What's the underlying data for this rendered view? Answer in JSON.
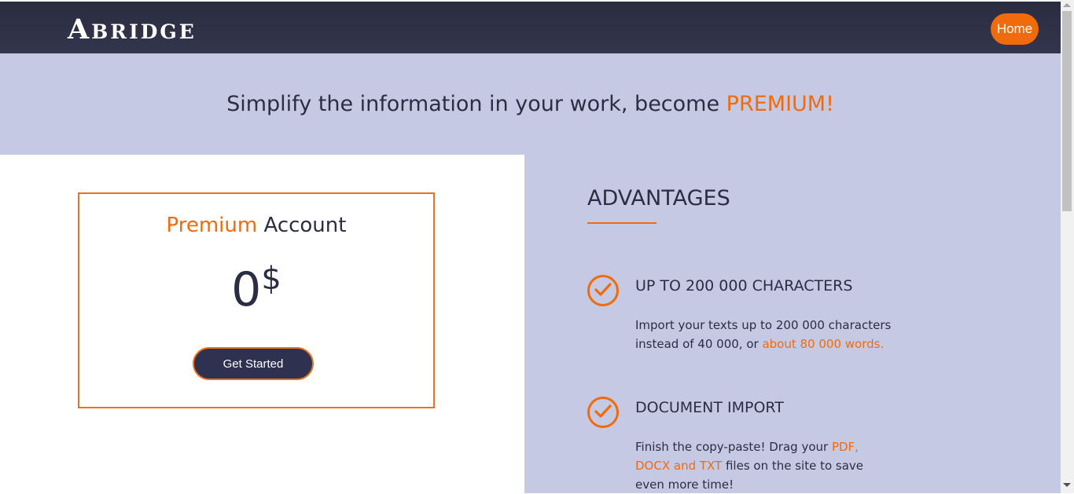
{
  "header": {
    "logo": "Abridge",
    "home_label": "Home"
  },
  "hero": {
    "title_prefix": "Simplify the information in your work, become ",
    "title_highlight": "PREMIUM!"
  },
  "pricing": {
    "title_highlight": "Premium",
    "title_rest": " Account",
    "price": "0",
    "currency": "$",
    "cta_label": "Get Started"
  },
  "advantages": {
    "title": "ADVANTAGES",
    "items": [
      {
        "icon": "check-circle-icon",
        "heading": "UP TO 200 000 CHARACTERS",
        "text_parts": [
          "Import your texts up to 200 000 characters instead of 40 000, or ",
          "about 80 000 words.",
          ""
        ]
      },
      {
        "icon": "check-circle-icon",
        "heading": "DOCUMENT IMPORT",
        "text_parts": [
          "Finish the copy-paste! Drag your ",
          "PDF, DOCX and TXT",
          " files on the site to save even more time!"
        ]
      }
    ]
  },
  "colors": {
    "accent": "#f06b0b",
    "navy": "#2e3150",
    "lavender": "#c6c9e4"
  }
}
